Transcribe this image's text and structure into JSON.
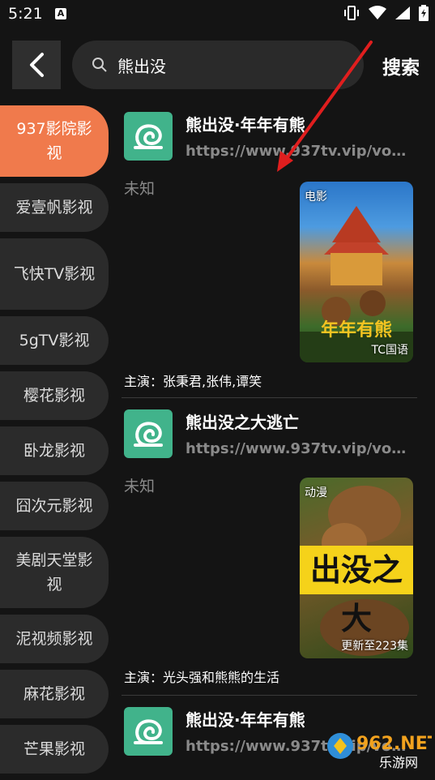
{
  "status": {
    "time": "5:21",
    "a_icon": "A"
  },
  "topbar": {
    "search_value": "熊出没",
    "search_button": "搜索"
  },
  "sidebar": {
    "items": [
      {
        "label": "937影院影视"
      },
      {
        "label": "爱壹帆影视"
      },
      {
        "label": "飞快TV影视"
      },
      {
        "label": "5gTV影视"
      },
      {
        "label": "樱花影视"
      },
      {
        "label": "卧龙影视"
      },
      {
        "label": "囧次元影视"
      },
      {
        "label": "美剧天堂影视"
      },
      {
        "label": "泥视频影视"
      },
      {
        "label": "麻花影视"
      },
      {
        "label": "芒果影视"
      }
    ]
  },
  "results": [
    {
      "title": "熊出没·年年有熊",
      "url": "https://www.937tv.vip/voddetail",
      "status": "未知",
      "poster_type": "电影",
      "poster_badge": "TC国语",
      "cast": "主演：张秉君,张伟,谭笑"
    },
    {
      "title": "熊出没之大逃亡",
      "url": "https://www.937tv.vip/voddetail",
      "status": "未知",
      "poster_type": "动漫",
      "poster_badge": "更新至223集",
      "poster_text": "出没之大",
      "cast": "主演：光头强和熊熊的生活"
    },
    {
      "title": "熊出没·年年有熊",
      "url": "https://www.937tv.vip/voddetail"
    }
  ],
  "watermark": {
    "top": "962.NET",
    "bottom": "乐游网"
  },
  "colors": {
    "accent": "#f07a4c",
    "background": "#141414",
    "logo": "#41b38b",
    "arrow": "#e01e1e"
  }
}
